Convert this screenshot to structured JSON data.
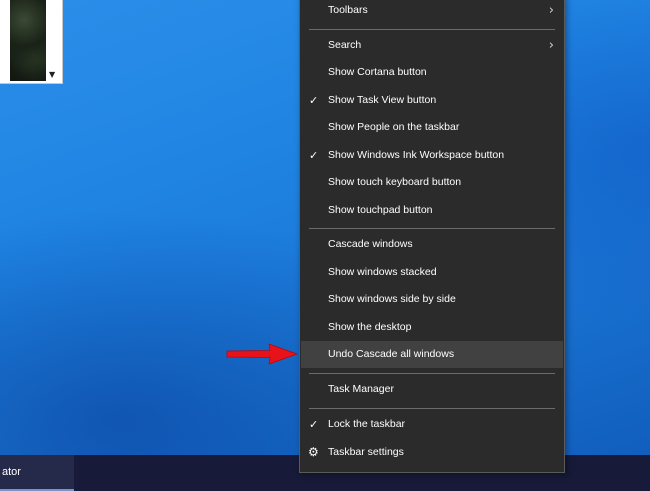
{
  "taskbar": {
    "item_label": "ator"
  },
  "menu": {
    "toolbars": "Toolbars",
    "search": "Search",
    "show_cortana": "Show Cortana button",
    "show_task_view": "Show Task View button",
    "show_people": "Show People on the taskbar",
    "show_ink": "Show Windows Ink Workspace button",
    "show_touch_keyboard": "Show touch keyboard button",
    "show_touchpad": "Show touchpad button",
    "cascade": "Cascade windows",
    "stacked": "Show windows stacked",
    "side_by_side": "Show windows side by side",
    "show_desktop": "Show the desktop",
    "undo_cascade": "Undo Cascade all windows",
    "task_manager": "Task Manager",
    "lock_taskbar": "Lock the taskbar",
    "taskbar_settings": "Taskbar settings"
  },
  "icons": {
    "check": "checkmark-icon",
    "submenu": "chevron-right-icon",
    "settings": "gear-icon",
    "annotation": "red-arrow-icon"
  },
  "colors": {
    "menu_background": "#2b2b2b",
    "menu_highlight": "#414141",
    "taskbar": "#171a38",
    "arrow": "#e8121a"
  }
}
